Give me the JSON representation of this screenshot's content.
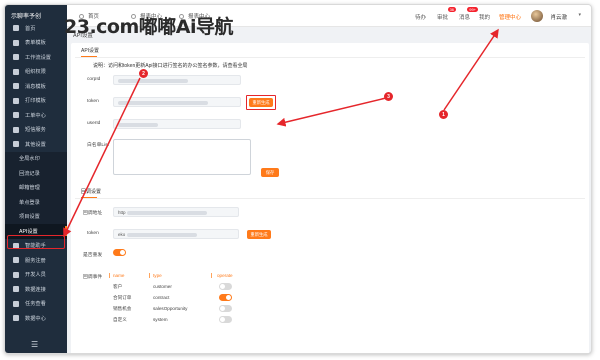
{
  "brand": "示聊率予创",
  "watermark": "23.com嘟嘟Ai导航",
  "sidebar": {
    "items": [
      {
        "label": "首页",
        "icon": "home-icon"
      },
      {
        "label": "表单模板",
        "icon": "form-icon"
      },
      {
        "label": "工作流设置",
        "icon": "share-icon"
      },
      {
        "label": "组织权限",
        "icon": "org-icon"
      },
      {
        "label": "消息模板",
        "icon": "message-icon"
      },
      {
        "label": "打印模板",
        "icon": "print-icon"
      },
      {
        "label": "工单中心",
        "icon": "ticket-icon"
      },
      {
        "label": "短信服务",
        "icon": "sms-icon"
      },
      {
        "label": "其他设置",
        "icon": "settings-icon"
      }
    ],
    "sub_items": [
      "全局水印",
      "回流记录",
      "邮箱管理",
      "单点登录",
      "项目设置",
      "API设置"
    ],
    "bottom_items": [
      {
        "label": "智能助手",
        "icon": "assistant-icon"
      },
      {
        "label": "服务注册",
        "icon": "service-icon"
      },
      {
        "label": "开发人员",
        "icon": "developer-icon"
      },
      {
        "label": "数据连接",
        "icon": "link-icon"
      },
      {
        "label": "任务查看",
        "icon": "task-icon"
      },
      {
        "label": "数据中心",
        "icon": "data-icon"
      }
    ],
    "collapse_glyph": "☰"
  },
  "topbar": {
    "tabs": [
      {
        "label": "首页",
        "icon": "home-icon"
      },
      {
        "label": "报表中心",
        "icon": "report-icon"
      },
      {
        "label": "报表中心",
        "icon": "report2-icon"
      }
    ],
    "links": [
      "待办",
      "审批",
      "消息",
      "我的",
      "管理中心"
    ],
    "badges": {
      "审批": "36",
      "消息": "99+"
    },
    "user_name": "肖云澈",
    "user_caret": "▾"
  },
  "breadcrumb": "API设置",
  "api_section": {
    "title": "API设置",
    "tip": "说明：访问和token更新Api接口进行签名的办公签名参数，请查看全局",
    "fields": [
      {
        "label": "corpId"
      },
      {
        "label": "token"
      },
      {
        "label": "userId"
      },
      {
        "label": "白名单List"
      }
    ],
    "regen_button": "重新生成",
    "save_button": "保存"
  },
  "callback_section": {
    "title": "回调设置",
    "url_label": "回调地址",
    "url_value": "http",
    "token_label": "token",
    "token_value": "eko",
    "regen_button": "重新生成",
    "retry_label": "是否重发",
    "retry_on": true,
    "events_label": "回调事件",
    "columns": [
      "name",
      "type",
      "operate"
    ],
    "rows": [
      {
        "name": "客户",
        "type": "customer",
        "on": false
      },
      {
        "name": "合同订单",
        "type": "contract",
        "on": true
      },
      {
        "name": "销售机会",
        "type": "salesOpportunity",
        "on": false
      },
      {
        "name": "自定义",
        "type": "system",
        "on": false
      }
    ]
  },
  "annotations": [
    "1",
    "2",
    "3"
  ],
  "colors": {
    "accent": "#ff7a1a",
    "sidebar": "#1f2d3d",
    "annotation": "#e5262b"
  }
}
